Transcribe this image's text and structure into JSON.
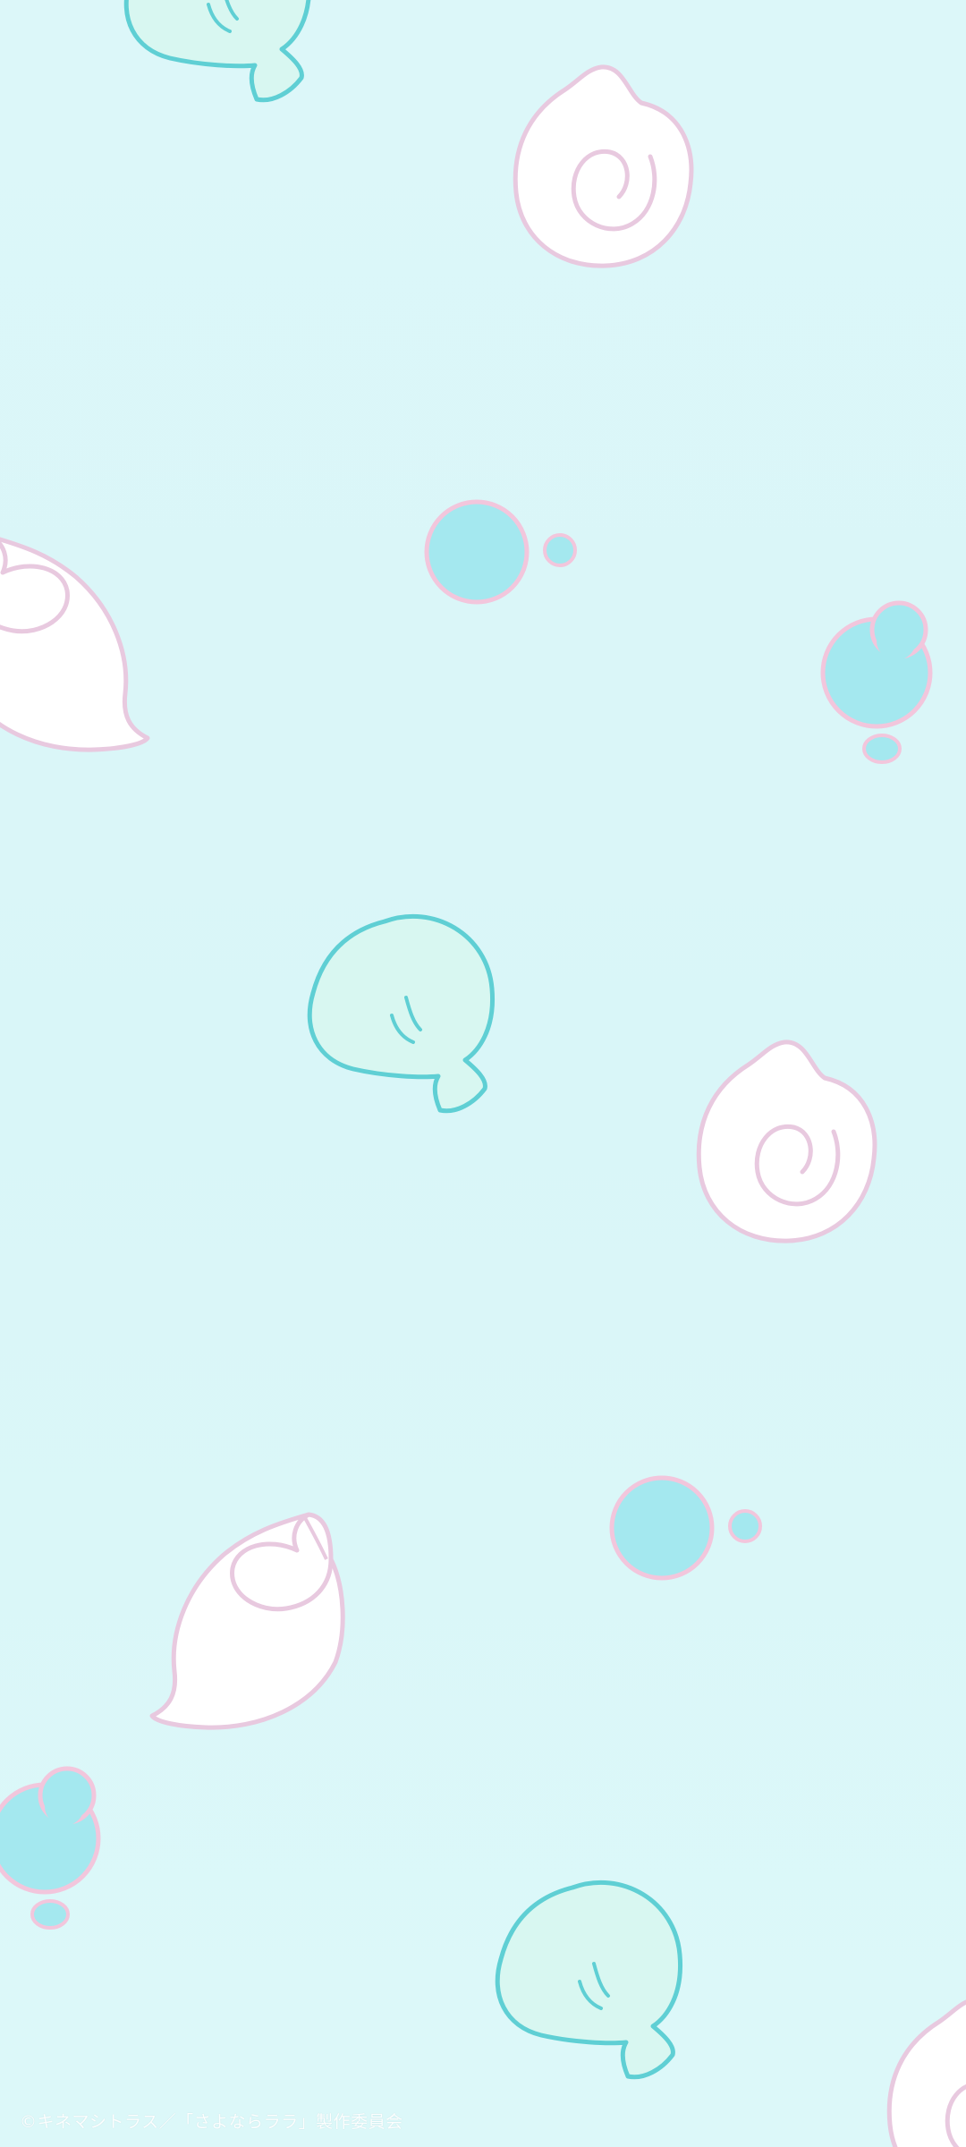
{
  "wallpaper": {
    "copyright": "©キネマシトラス／「さよならララ」製作委員会",
    "decorations": [
      "scallop-shell-icon",
      "spiral-shell-icon",
      "bubble-icon",
      "conch-shell-icon",
      "bubble-cluster-icon"
    ]
  },
  "colors": {
    "background": "#dcf7f9",
    "scallop_fill": "#d8f7f1",
    "scallop_outline": "#5fcfd4",
    "shell_fill": "#ffffff",
    "shell_outline": "#e8c9df",
    "bubble_fill": "#a4e8ef",
    "bubble_outline": "#f2c6dc"
  }
}
